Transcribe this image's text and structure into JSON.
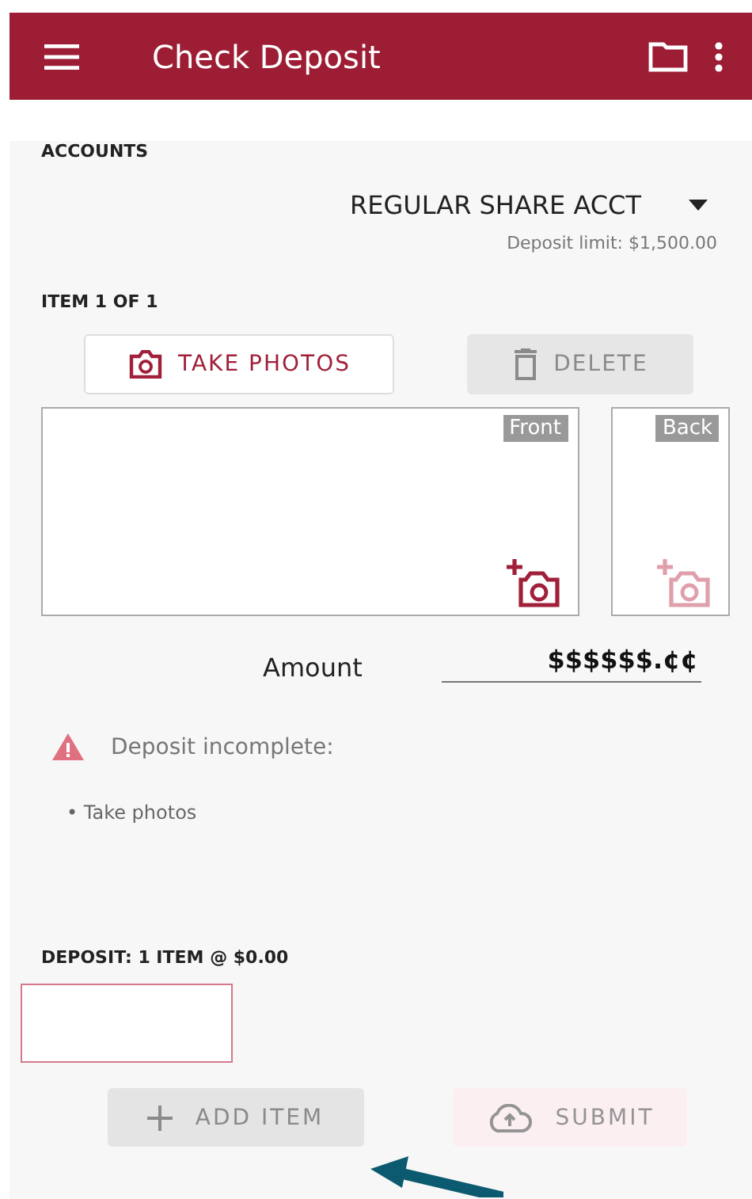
{
  "app_bar": {
    "title": "Check Deposit"
  },
  "accounts": {
    "heading": "ACCOUNTS",
    "selected_account": "REGULAR SHARE ACCT",
    "deposit_limit": "Deposit limit: $1,500.00"
  },
  "item": {
    "heading": "ITEM 1 OF 1",
    "actions": [
      {
        "label": "TAKE PHOTOS",
        "kind": "camera",
        "disabled": false
      },
      {
        "label": "DELETE",
        "kind": "trash",
        "disabled": true
      }
    ],
    "photos": [
      {
        "label": "Front",
        "disabled": false
      },
      {
        "label": "Back",
        "disabled": true
      }
    ],
    "amount": {
      "label": "Amount",
      "placeholder": "$$$$$$.¢¢"
    }
  },
  "warning": {
    "title": "Deposit incomplete:",
    "bullets": [
      "• Take photos"
    ]
  },
  "summary": "DEPOSIT: 1 ITEM @ $0.00",
  "footer_buttons": [
    {
      "label": "ADD ITEM",
      "kind": "add",
      "disabled": true
    },
    {
      "label": "SUBMIT",
      "kind": "upload",
      "disabled": true
    }
  ]
}
